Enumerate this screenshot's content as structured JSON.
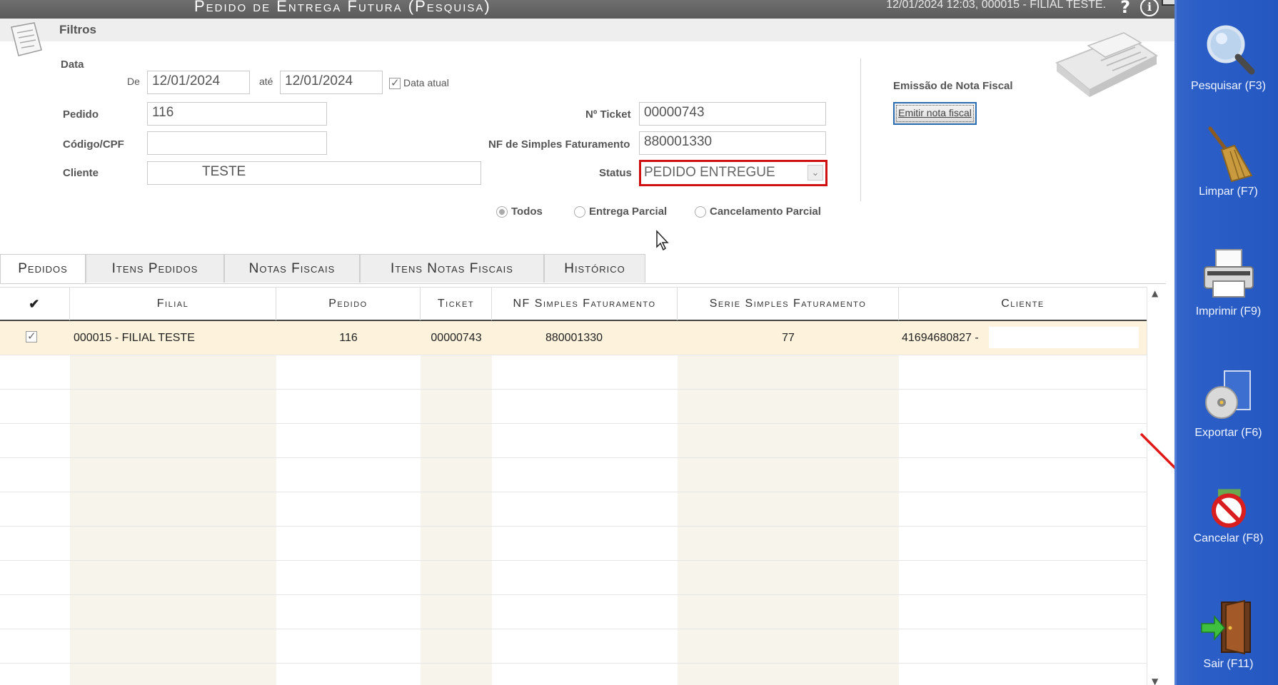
{
  "window": {
    "title": "Pedido de Entrega Futura (Pesquisa)",
    "status": "12/01/2024 12:03, 000015 - FILIAL TESTE."
  },
  "filters": {
    "title": "Filtros",
    "data_label": "Data",
    "de_label": "De",
    "date_from": "12/01/2024",
    "ate_label": "até",
    "date_to": "12/01/2024",
    "data_atual_label": "Data atual",
    "data_atual_checked": true,
    "pedido_label": "Pedido",
    "pedido_value": "116",
    "codigo_label": "Código/CPF",
    "codigo_value": "",
    "cliente_label": "Cliente",
    "cliente_value": "TESTE",
    "ticket_label": "Nº Ticket",
    "ticket_value": "00000743",
    "nf_label": "NF de Simples Faturamento",
    "nf_value": "880001330",
    "status_label": "Status",
    "status_value": "PEDIDO ENTREGUE",
    "radio_todos": "Todos",
    "radio_entrega": "Entrega Parcial",
    "radio_cancelamento": "Cancelamento Parcial",
    "radio_selected": "Todos"
  },
  "nota_fiscal": {
    "title": "Emissão de Nota Fiscal",
    "button": "Emitir nota fiscal"
  },
  "tabs": [
    "Pedidos",
    "Itens Pedidos",
    "Notas Fiscais",
    "Itens Notas Fiscais",
    "Histórico"
  ],
  "grid": {
    "headers": {
      "check": "✔",
      "filial": "Filial",
      "pedido": "Pedido",
      "ticket": "Ticket",
      "nf": "NF Simples Faturamento",
      "serie": "Serie Simples Faturamento",
      "cliente": "Cliente"
    },
    "rows": [
      {
        "checked": true,
        "filial": "000015 - FILIAL TESTE",
        "pedido": "116",
        "ticket": "00000743",
        "nf": "880001330",
        "serie": "77",
        "cliente": "41694680827 -"
      }
    ]
  },
  "toolbar": {
    "pesquisar": "Pesquisar (F3)",
    "limpar": "Limpar (F7)",
    "imprimir": "Imprimir (F9)",
    "exportar": "Exportar (F6)",
    "cancelar": "Cancelar (F8)",
    "sair": "Sair (F11)"
  },
  "colors": {
    "sidebar": "#2557c0",
    "highlight_border": "#d01010",
    "selected_row": "#fdf3dc",
    "annotation_arrow": "#e01818"
  }
}
